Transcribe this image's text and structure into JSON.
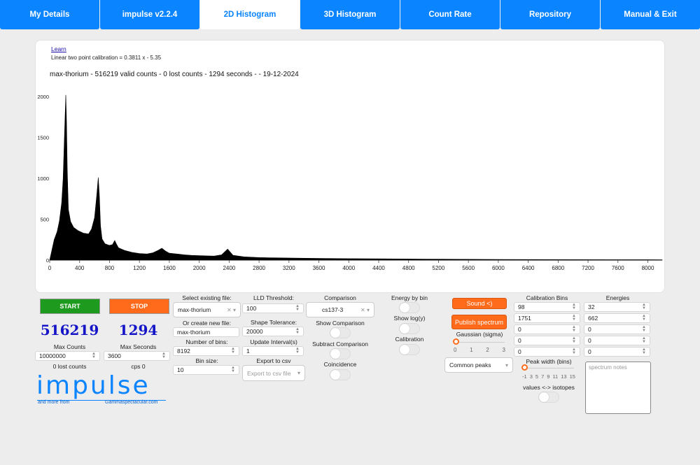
{
  "tabs": [
    {
      "label": "My Details"
    },
    {
      "label": "impulse v2.2.4"
    },
    {
      "label": "2D Histogram",
      "active": true
    },
    {
      "label": "3D Histogram"
    },
    {
      "label": "Count Rate"
    },
    {
      "label": "Repository"
    },
    {
      "label": "Manual & Exit"
    }
  ],
  "panel": {
    "learn": "Learn",
    "calibration": "Linear two point calibration = 0.3811 x - 5.35",
    "title": "max-thorium - 516219 valid counts - 0 lost counts - 1294 seconds -  - 19-12-2024"
  },
  "chart_data": {
    "type": "area",
    "title": "max-thorium - 516219 valid counts - 0 lost counts - 1294 seconds -  - 19-12-2024",
    "xlabel": "",
    "ylabel": "",
    "xlim": [
      0,
      8192
    ],
    "ylim": [
      0,
      2000
    ],
    "xticks": [
      0,
      400,
      800,
      1200,
      1600,
      2000,
      2400,
      2800,
      3200,
      3600,
      4000,
      4400,
      4800,
      5200,
      5600,
      6000,
      6400,
      6800,
      7200,
      7600,
      8000
    ],
    "yticks": [
      0,
      500,
      1000,
      1500,
      2000
    ],
    "grid": false,
    "series": [
      {
        "x": [
          0,
          60,
          100,
          130,
          160,
          180,
          200,
          215,
          225,
          235,
          250,
          280,
          320,
          380,
          450,
          520,
          560,
          600,
          630,
          650,
          665,
          680,
          700,
          740,
          800,
          840,
          870,
          890,
          920,
          1000,
          1100,
          1200,
          1300,
          1380,
          1450,
          1500,
          1550,
          1600,
          1700,
          1800,
          1900,
          2000,
          2100,
          2200,
          2300,
          2380,
          2450,
          2600,
          2800,
          3000,
          3500,
          4000,
          4500,
          5000,
          5500,
          6000,
          6500,
          7000,
          7500,
          8000,
          8192
        ],
        "values": [
          0,
          250,
          350,
          480,
          700,
          1000,
          1600,
          2020,
          1700,
          1100,
          620,
          470,
          400,
          360,
          330,
          320,
          380,
          520,
          800,
          1010,
          780,
          420,
          260,
          200,
          180,
          190,
          240,
          200,
          150,
          120,
          95,
          80,
          75,
          90,
          120,
          145,
          110,
          85,
          75,
          65,
          58,
          55,
          52,
          50,
          65,
          135,
          60,
          40,
          32,
          28,
          22,
          18,
          15,
          12,
          10,
          8,
          7,
          6,
          5,
          5,
          4
        ]
      }
    ]
  },
  "controls": {
    "start": "START",
    "stop": "STOP",
    "counts_value": "516219",
    "seconds_value": "1294",
    "max_counts_label": "Max Counts",
    "max_counts_value": "10000000",
    "max_seconds_label": "Max Seconds",
    "max_seconds_value": "3600",
    "lost_counts": "0 lost counts",
    "cps": "cps 0",
    "logo": "impulse",
    "logo_sub_left": "and more from",
    "logo_sub_right": "Gammaspectacular.com",
    "select_file_label": "Select existing file:",
    "select_file_value": "max-thorium",
    "new_file_label": "Or create new file:",
    "new_file_value": "max-thorium",
    "bins_label": "Number of bins:",
    "bins_value": "8192",
    "bin_size_label": "Bin size:",
    "bin_size_value": "10",
    "lld_label": "LLD Threshold:",
    "lld_value": "100",
    "shape_label": "Shape Tolerance:",
    "shape_value": "20000",
    "update_label": "Update Interval(s)",
    "update_value": "1",
    "export_label": "Export to csv",
    "export_placeholder": "Export to csv file",
    "comparison_label": "Comparison",
    "comparison_value": "cs137-3",
    "show_comparison": "Show Comparison",
    "subtract_comparison": "Subtract Comparison",
    "coincidence": "Coincidence",
    "energy_by_bin": "Energy by bin",
    "show_log": "Show log(y)",
    "calibration": "Calibration",
    "sound": "Sound <)",
    "publish": "Publish spectrum",
    "gaussian_label": "Gaussian (sigma)",
    "gaussian_ticks": [
      "0",
      "1",
      "2",
      "3"
    ],
    "common_peaks": "Common peaks",
    "calib_bins_label": "Calibration Bins",
    "calib_bins": [
      "98",
      "1751",
      "0",
      "0",
      "0"
    ],
    "energies_label": "Energies",
    "energies": [
      "32",
      "662",
      "0",
      "0",
      "0"
    ],
    "peak_width_label": "Peak width (bins)",
    "peak_width_ticks": [
      "-1",
      "3",
      "5",
      "7",
      "9",
      "11",
      "13",
      "15"
    ],
    "isotopes_label": "values <-> isotopes",
    "notes_placeholder": "spectrum notes"
  }
}
